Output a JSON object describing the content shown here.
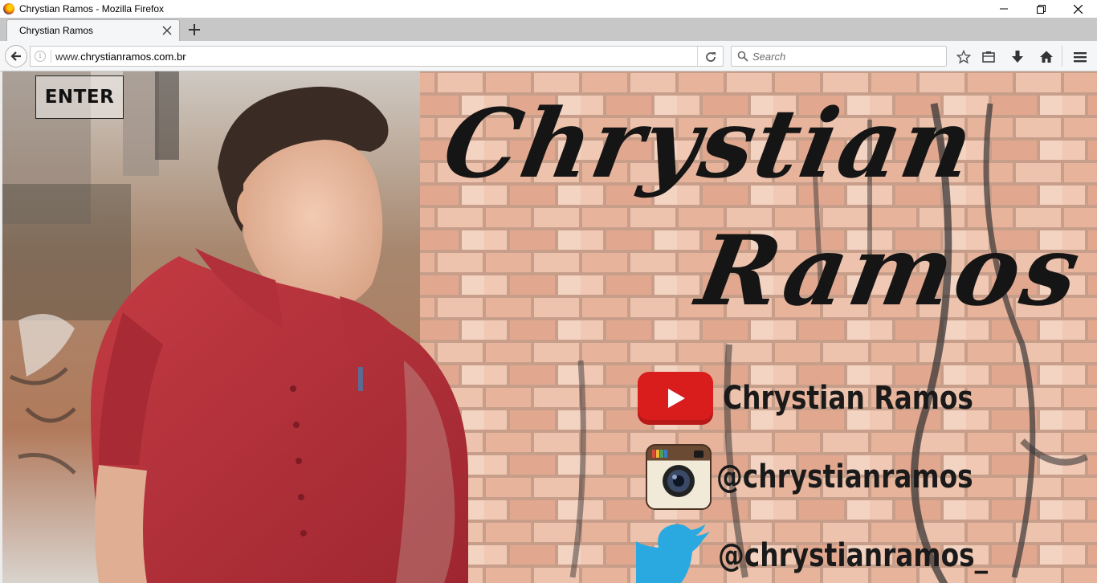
{
  "window": {
    "title": "Chrystian Ramos - Mozilla Firefox",
    "controls": {
      "minimize": "minimize",
      "maximize": "restore",
      "close": "close"
    }
  },
  "tabs": [
    {
      "label": "Chrystian Ramos",
      "active": true
    }
  ],
  "navbar": {
    "url_prefix": "www.",
    "url_host": "chrystianramos.com.br",
    "search_placeholder": "Search"
  },
  "page": {
    "enter_label": "ENTER",
    "name_first": "Chrystian",
    "name_last": "Ramos",
    "social": [
      {
        "network": "youtube",
        "label": "Chrystian  Ramos"
      },
      {
        "network": "instagram",
        "label": "@chrystianramos"
      },
      {
        "network": "twitter",
        "label": "@chrystianramos_"
      }
    ]
  },
  "colors": {
    "chrome_bg": "#f5f6f7",
    "tab_strip": "#c7c7c7",
    "shirt_red": "#b8323a",
    "youtube_red": "#d91d1d",
    "twitter_blue": "#2aa9e0",
    "brick": "#d89a7e"
  }
}
